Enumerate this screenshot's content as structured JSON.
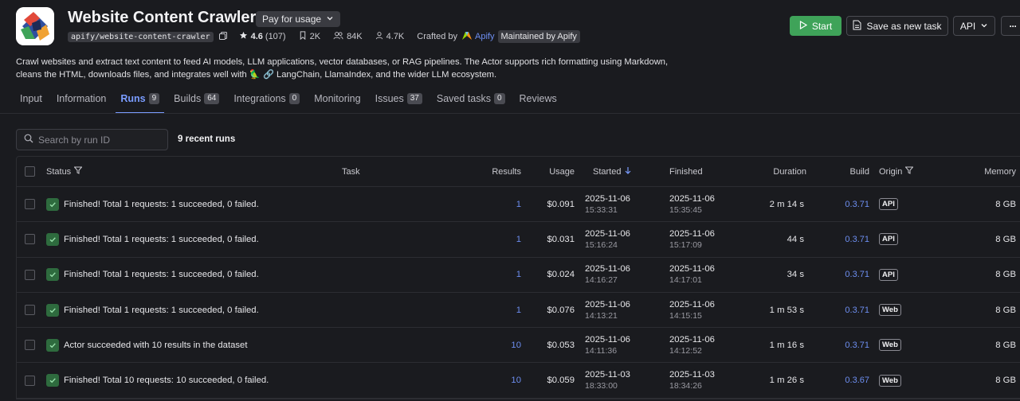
{
  "header": {
    "title": "Website Content Crawler",
    "pricing": "Pay for usage",
    "slug": "apify/website-content-crawler",
    "rating": "4.6",
    "rating_count": "(107)",
    "bookmarks": "2K",
    "users": "84K",
    "monthly_users": "4.7K",
    "crafted_by_label": "Crafted by",
    "author": "Apify",
    "maintained": "Maintained by Apify"
  },
  "actions": {
    "start": "Start",
    "save": "Save as new task",
    "api": "API",
    "more": "···"
  },
  "description": {
    "line1": "Crawl websites and extract text content to feed AI models, LLM applications, vector databases, or RAG pipelines. The Actor supports rich formatting using Markdown,",
    "line2_a": "cleans the HTML, downloads files, and integrates well with",
    "line2_b": "LangChain, LlamaIndex, and the wider LLM ecosystem."
  },
  "tabs": [
    {
      "label": "Input",
      "count": ""
    },
    {
      "label": "Information",
      "count": ""
    },
    {
      "label": "Runs",
      "count": "9"
    },
    {
      "label": "Builds",
      "count": "64"
    },
    {
      "label": "Integrations",
      "count": "0"
    },
    {
      "label": "Monitoring",
      "count": ""
    },
    {
      "label": "Issues",
      "count": "37"
    },
    {
      "label": "Saved tasks",
      "count": "0"
    },
    {
      "label": "Reviews",
      "count": ""
    }
  ],
  "search": {
    "placeholder": "Search by run ID"
  },
  "recent_runs": "9 recent runs",
  "columns": {
    "status": "Status",
    "task": "Task",
    "results": "Results",
    "usage": "Usage",
    "started": "Started",
    "finished": "Finished",
    "duration": "Duration",
    "build": "Build",
    "origin": "Origin",
    "memory": "Memory"
  },
  "rows": [
    {
      "status": "Finished! Total 1 requests: 1 succeeded, 0 failed.",
      "results": "1",
      "usage": "$0.091",
      "started_date": "2025-11-06",
      "started_time": "15:33:31",
      "finished_date": "2025-11-06",
      "finished_time": "15:35:45",
      "duration": "2 m 14 s",
      "build": "0.3.71",
      "origin": "API",
      "memory": "8 GB"
    },
    {
      "status": "Finished! Total 1 requests: 1 succeeded, 0 failed.",
      "results": "1",
      "usage": "$0.031",
      "started_date": "2025-11-06",
      "started_time": "15:16:24",
      "finished_date": "2025-11-06",
      "finished_time": "15:17:09",
      "duration": "44 s",
      "build": "0.3.71",
      "origin": "API",
      "memory": "8 GB"
    },
    {
      "status": "Finished! Total 1 requests: 1 succeeded, 0 failed.",
      "results": "1",
      "usage": "$0.024",
      "started_date": "2025-11-06",
      "started_time": "14:16:27",
      "finished_date": "2025-11-06",
      "finished_time": "14:17:01",
      "duration": "34 s",
      "build": "0.3.71",
      "origin": "API",
      "memory": "8 GB"
    },
    {
      "status": "Finished! Total 1 requests: 1 succeeded, 0 failed.",
      "results": "1",
      "usage": "$0.076",
      "started_date": "2025-11-06",
      "started_time": "14:13:21",
      "finished_date": "2025-11-06",
      "finished_time": "14:15:15",
      "duration": "1 m 53 s",
      "build": "0.3.71",
      "origin": "Web",
      "memory": "8 GB"
    },
    {
      "status": "Actor succeeded with 10 results in the dataset",
      "results": "10",
      "usage": "$0.053",
      "started_date": "2025-11-06",
      "started_time": "14:11:36",
      "finished_date": "2025-11-06",
      "finished_time": "14:12:52",
      "duration": "1 m 16 s",
      "build": "0.3.71",
      "origin": "Web",
      "memory": "8 GB"
    },
    {
      "status": "Finished! Total 10 requests: 10 succeeded, 0 failed.",
      "results": "10",
      "usage": "$0.059",
      "started_date": "2025-11-03",
      "started_time": "18:33:00",
      "finished_date": "2025-11-03",
      "finished_time": "18:34:26",
      "duration": "1 m 26 s",
      "build": "0.3.67",
      "origin": "Web",
      "memory": "8 GB"
    }
  ],
  "colors": {
    "background": "#1a1b1f",
    "accent": "#7a9cff",
    "success": "#3fa359",
    "link": "#6d8ef0"
  }
}
